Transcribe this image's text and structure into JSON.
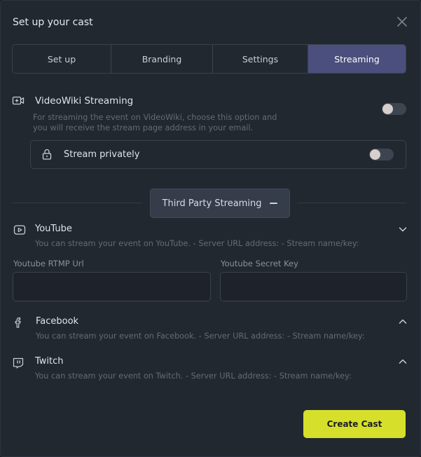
{
  "modal": {
    "title": "Set up your cast",
    "close_icon": "close-icon"
  },
  "tabs": [
    {
      "label": "Set up",
      "active": false
    },
    {
      "label": "Branding",
      "active": false
    },
    {
      "label": "Settings",
      "active": false
    },
    {
      "label": "Streaming",
      "active": true
    }
  ],
  "videowiki": {
    "title": "VideoWiki Streaming",
    "description_line1": "For streaming the event on VideoWiki, choose this option and",
    "description_line2": "you will receive the stream page address in your email.",
    "enabled": false,
    "icon": "video-add-icon"
  },
  "stream_private": {
    "label": "Stream privately",
    "enabled": false,
    "icon": "lock-icon"
  },
  "third_party": {
    "label": "Third Party Streaming",
    "icon": "minus-icon"
  },
  "youtube": {
    "title": "YouTube",
    "description": "You can stream your event on YouTube. - Server URL address: - Stream name/key:",
    "rtmp_label": "Youtube RTMP Url",
    "rtmp_value": "",
    "secret_label": "Youtube Secret Key",
    "secret_value": "",
    "icon": "youtube-icon"
  },
  "facebook": {
    "title": "Facebook",
    "description": "You can stream your event on Facebook. - Server URL address: - Stream name/key:",
    "icon": "facebook-icon"
  },
  "twitch": {
    "title": "Twitch",
    "description": "You can stream your event on Twitch. - Server URL address: - Stream name/key:",
    "icon": "twitch-icon"
  },
  "actions": {
    "create_label": "Create Cast"
  },
  "colors": {
    "accent_tab": "#4b4f7d",
    "create_button": "#d6e02a",
    "background": "#222830"
  }
}
